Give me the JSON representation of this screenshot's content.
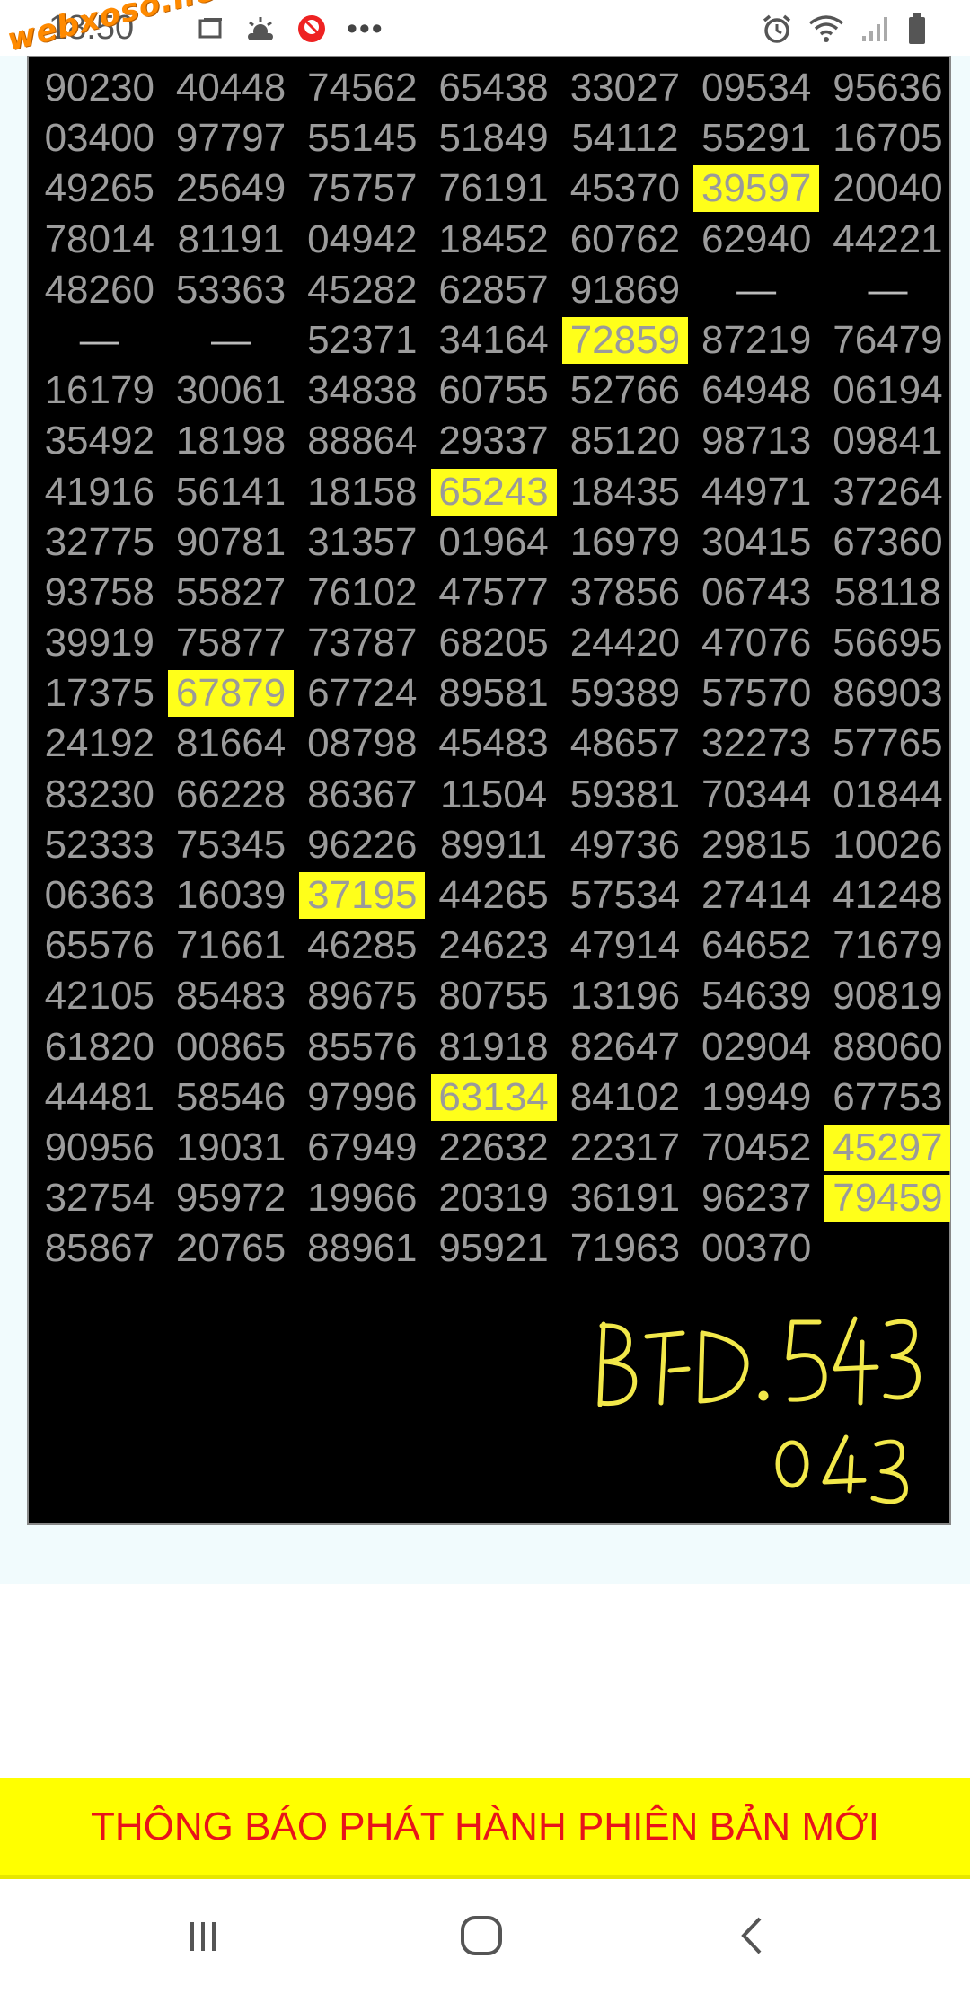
{
  "status_bar": {
    "time": "18:50",
    "watermark": "webxoso.net",
    "icons_left": [
      "gallery-icon",
      "weather-icon",
      "app-notification-icon",
      "more-dots-icon"
    ],
    "icons_right": [
      "alarm-icon",
      "wifi-icon",
      "signal-icon",
      "battery-icon"
    ]
  },
  "board": {
    "rows": [
      [
        "90230",
        "40448",
        "74562",
        "65438",
        "33027",
        "09534",
        "95636"
      ],
      [
        "03400",
        "97797",
        "55145",
        "51849",
        "54112",
        "55291",
        "16705"
      ],
      [
        "49265",
        "25649",
        "75757",
        "76191",
        "45370",
        "39597",
        "20040"
      ],
      [
        "78014",
        "81191",
        "04942",
        "18452",
        "60762",
        "62940",
        "44221"
      ],
      [
        "48260",
        "53363",
        "45282",
        "62857",
        "91869",
        "—",
        "—"
      ],
      [
        "—",
        "—",
        "52371",
        "34164",
        "72859",
        "87219",
        "76479"
      ],
      [
        "16179",
        "30061",
        "34838",
        "60755",
        "52766",
        "64948",
        "06194"
      ],
      [
        "35492",
        "18198",
        "88864",
        "29337",
        "85120",
        "98713",
        "09841"
      ],
      [
        "41916",
        "56141",
        "18158",
        "65243",
        "18435",
        "44971",
        "37264"
      ],
      [
        "32775",
        "90781",
        "31357",
        "01964",
        "16979",
        "30415",
        "67360"
      ],
      [
        "93758",
        "55827",
        "76102",
        "47577",
        "37856",
        "06743",
        "58118"
      ],
      [
        "39919",
        "75877",
        "73787",
        "68205",
        "24420",
        "47076",
        "56695"
      ],
      [
        "17375",
        "67879",
        "67724",
        "89581",
        "59389",
        "57570",
        "86903"
      ],
      [
        "24192",
        "81664",
        "08798",
        "45483",
        "48657",
        "32273",
        "57765"
      ],
      [
        "83230",
        "66228",
        "86367",
        "11504",
        "59381",
        "70344",
        "01844"
      ],
      [
        "52333",
        "75345",
        "96226",
        "89911",
        "49736",
        "29815",
        "10026"
      ],
      [
        "06363",
        "16039",
        "37195",
        "44265",
        "57534",
        "27414",
        "41248"
      ],
      [
        "65576",
        "71661",
        "46285",
        "24623",
        "47914",
        "64652",
        "71679"
      ],
      [
        "42105",
        "85483",
        "89675",
        "80755",
        "13196",
        "54639",
        "90819"
      ],
      [
        "61820",
        "00865",
        "85576",
        "81918",
        "82647",
        "02904",
        "88060"
      ],
      [
        "44481",
        "58546",
        "97996",
        "63134",
        "84102",
        "19949",
        "67753"
      ],
      [
        "90956",
        "19031",
        "67949",
        "22632",
        "22317",
        "70452",
        "45297"
      ],
      [
        "32754",
        "95972",
        "19966",
        "20319",
        "36191",
        "96237",
        "79459"
      ],
      [
        "85867",
        "20765",
        "88961",
        "95921",
        "71963",
        "00370",
        ""
      ]
    ],
    "highlighted": [
      [
        2,
        5
      ],
      [
        5,
        4
      ],
      [
        8,
        3
      ],
      [
        12,
        1
      ],
      [
        16,
        2
      ],
      [
        20,
        3
      ],
      [
        21,
        6
      ],
      [
        22,
        6
      ]
    ],
    "highlight_color": "#ffff1a",
    "text_color": "#9c9c9c",
    "background_color": "#000000",
    "handwritten_note_lines": [
      "BT-D. 543",
      "043"
    ],
    "handwriting_color": "#f2e84a"
  },
  "banner": {
    "text": "THÔNG BÁO PHÁT HÀNH PHIÊN BẢN MỚI",
    "background": "#ffff00",
    "text_color": "#e8141a"
  },
  "nav_bar": {
    "buttons": [
      "recent-apps-button",
      "home-button",
      "back-button"
    ]
  }
}
